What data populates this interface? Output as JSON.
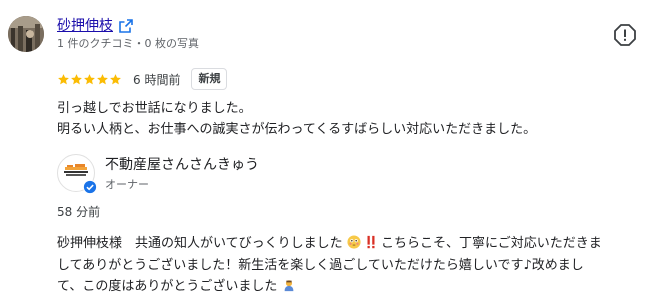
{
  "reviewer": {
    "name": "砂押伸枝",
    "meta": "1 件のクチコミ・0 枚の写真"
  },
  "review": {
    "rating": 5,
    "time_ago": "6 時間前",
    "badge": "新規",
    "text_lines": [
      "引っ越しでお世話になりました。",
      "明るい人柄と、お仕事への誠実さが伝わってくるすばらしい対応いただきました。"
    ]
  },
  "owner_reply": {
    "owner_name": "不動産屋さんさんきゅう",
    "role": "オーナー",
    "logo_text": "不動産屋さん さんきゅう",
    "time_ago": "58 分前",
    "line1_pre": "砂押伸枝様　共通の知人がいてびっくりしました",
    "line1_post": "こちらこそ、丁寧にご対応いただきま",
    "line2": "してありがとうございました！新生活を楽しく過ごしていただけたら嬉しいです♪改めまし",
    "line3": "て、この度はありがとうございました"
  },
  "colors": {
    "star": "#fbbc04",
    "link": "#1a0dab",
    "verified": "#1a73e8"
  },
  "icons": {
    "external": "external-link-icon",
    "report": "report-icon",
    "verified": "verified-check-icon"
  }
}
